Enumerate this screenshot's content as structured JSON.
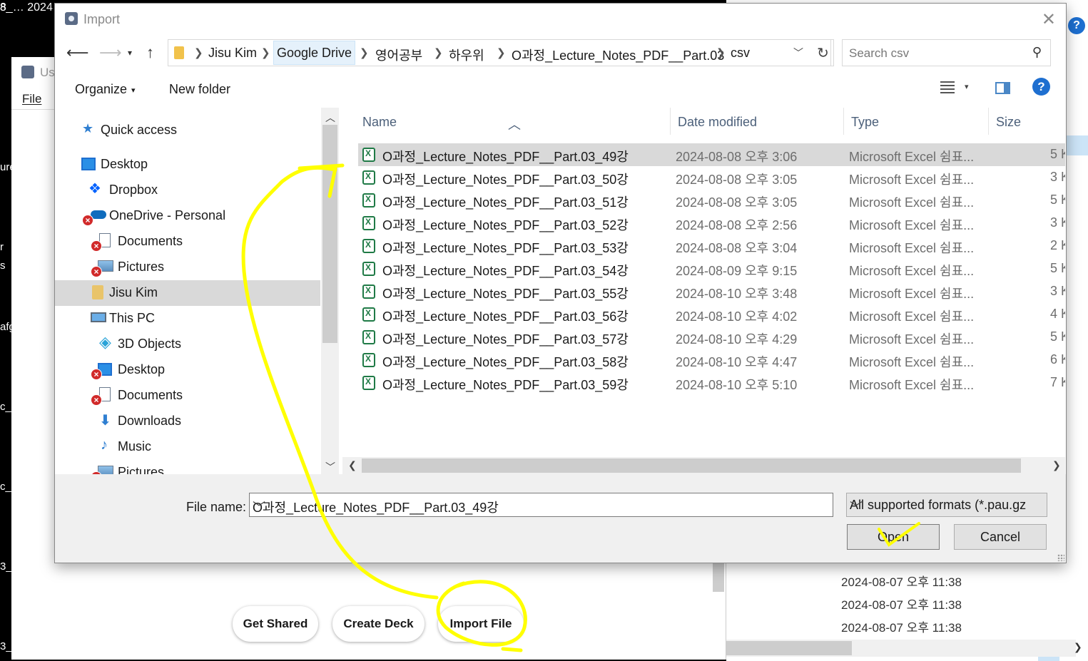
{
  "background": {
    "top_strip_text": "8_…  2024…",
    "left_fragments": [
      "8_",
      "ure",
      "r",
      "s",
      "afg",
      "c_2",
      "c_2",
      "3_",
      "3_"
    ],
    "app_title": "Us",
    "app_menu_file": "File",
    "buttons": {
      "get_shared": "Get Shared",
      "create_deck": "Create Deck",
      "import_file": "Import File"
    },
    "dates": [
      "2024-08-07 오후 11:38",
      "2024-08-07 오후 11:38",
      "2024-08-07 오후 11:38"
    ]
  },
  "dialog": {
    "title": "Import",
    "breadcrumbs": [
      "Jisu Kim",
      "Google Drive",
      "영어공부",
      "하우위",
      "O과정_Lecture_Notes_PDF__Part.03",
      "csv"
    ],
    "search_placeholder": "Search csv",
    "toolbar": {
      "organize": "Organize",
      "new_folder": "New folder"
    },
    "nav_items": [
      {
        "label": "Quick access",
        "icon": "star-icon"
      },
      {
        "label": "Desktop",
        "icon": "desktop-icon"
      },
      {
        "label": "Dropbox",
        "icon": "dropbox-icon"
      },
      {
        "label": "OneDrive - Personal",
        "icon": "onedrive-icon"
      },
      {
        "label": "Documents",
        "icon": "documents-icon"
      },
      {
        "label": "Pictures",
        "icon": "pictures-icon"
      },
      {
        "label": "Jisu Kim",
        "icon": "user-folder-icon"
      },
      {
        "label": "This PC",
        "icon": "computer-icon"
      },
      {
        "label": "3D Objects",
        "icon": "cube-icon"
      },
      {
        "label": "Desktop",
        "icon": "desktop-icon"
      },
      {
        "label": "Documents",
        "icon": "documents-icon"
      },
      {
        "label": "Downloads",
        "icon": "download-icon"
      },
      {
        "label": "Music",
        "icon": "music-icon"
      },
      {
        "label": "Pictures",
        "icon": "pictures-icon"
      }
    ],
    "columns": {
      "name": "Name",
      "date": "Date modified",
      "type": "Type",
      "size": "Size"
    },
    "files": [
      {
        "name": "O과정_Lecture_Notes_PDF__Part.03_49강",
        "date": "2024-08-08 오후 3:06",
        "type": "Microsoft Excel 쉼표...",
        "size": "5 K"
      },
      {
        "name": "O과정_Lecture_Notes_PDF__Part.03_50강",
        "date": "2024-08-08 오후 3:05",
        "type": "Microsoft Excel 쉼표...",
        "size": "3 K"
      },
      {
        "name": "O과정_Lecture_Notes_PDF__Part.03_51강",
        "date": "2024-08-08 오후 3:05",
        "type": "Microsoft Excel 쉼표...",
        "size": "5 K"
      },
      {
        "name": "O과정_Lecture_Notes_PDF__Part.03_52강",
        "date": "2024-08-08 오후 2:56",
        "type": "Microsoft Excel 쉼표...",
        "size": "3 K"
      },
      {
        "name": "O과정_Lecture_Notes_PDF__Part.03_53강",
        "date": "2024-08-08 오후 3:04",
        "type": "Microsoft Excel 쉼표...",
        "size": "2 K"
      },
      {
        "name": "O과정_Lecture_Notes_PDF__Part.03_54강",
        "date": "2024-08-09 오후 9:15",
        "type": "Microsoft Excel 쉼표...",
        "size": "5 K"
      },
      {
        "name": "O과정_Lecture_Notes_PDF__Part.03_55강",
        "date": "2024-08-10 오후 3:48",
        "type": "Microsoft Excel 쉼표...",
        "size": "3 K"
      },
      {
        "name": "O과정_Lecture_Notes_PDF__Part.03_56강",
        "date": "2024-08-10 오후 4:02",
        "type": "Microsoft Excel 쉼표...",
        "size": "4 K"
      },
      {
        "name": "O과정_Lecture_Notes_PDF__Part.03_57강",
        "date": "2024-08-10 오후 4:29",
        "type": "Microsoft Excel 쉼표...",
        "size": "5 K"
      },
      {
        "name": "O과정_Lecture_Notes_PDF__Part.03_58강",
        "date": "2024-08-10 오후 4:47",
        "type": "Microsoft Excel 쉼표...",
        "size": "6 K"
      },
      {
        "name": "O과정_Lecture_Notes_PDF__Part.03_59강",
        "date": "2024-08-10 오후 5:10",
        "type": "Microsoft Excel 쉼표...",
        "size": "7 K"
      }
    ],
    "file_name_label": "File name:",
    "file_name_value": "O과정_Lecture_Notes_PDF__Part.03_49강",
    "file_type_value": "All supported formats (*.pau.gz",
    "open_label": "Open",
    "cancel_label": "Cancel"
  },
  "colors": {
    "annotation": "#ffff00",
    "selection": "#d9d9d9",
    "accent": "#1e6fd0"
  }
}
